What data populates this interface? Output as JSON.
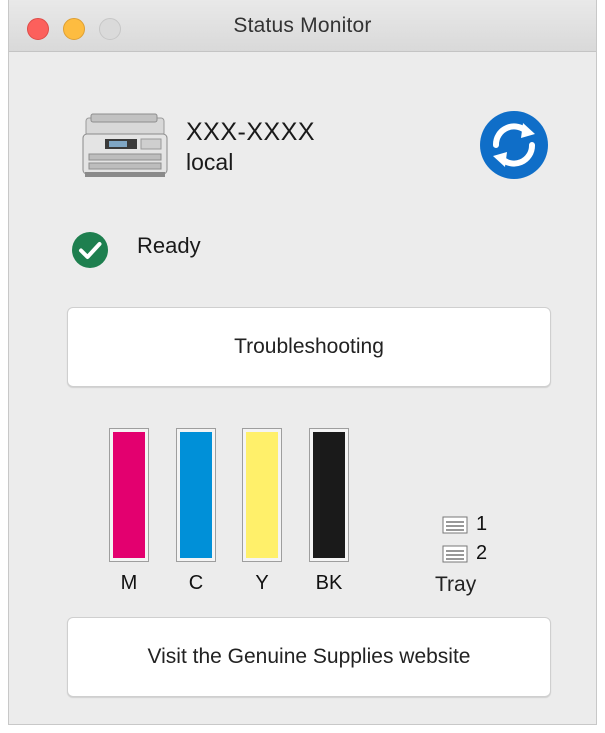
{
  "window": {
    "title": "Status Monitor"
  },
  "device": {
    "name": "XXX-XXXX",
    "connection": "local"
  },
  "status": {
    "text": "Ready",
    "color": "#1e7f4f"
  },
  "buttons": {
    "troubleshooting": "Troubleshooting",
    "supplies": "Visit the Genuine Supplies website"
  },
  "ink": [
    {
      "label": "M",
      "color": "#e3006f",
      "level": 1.0
    },
    {
      "label": "C",
      "color": "#0090d8",
      "level": 1.0
    },
    {
      "label": "Y",
      "color": "#fff06a",
      "level": 1.0
    },
    {
      "label": "BK",
      "color": "#1a1a1a",
      "level": 1.0
    }
  ],
  "trays": {
    "items": [
      "1",
      "2"
    ],
    "label": "Tray"
  },
  "icons": {
    "refresh": "refresh-icon",
    "printer": "printer-icon",
    "status": "check-circle-icon",
    "tray": "tray-icon"
  },
  "colors": {
    "accent": "#0f6ec8"
  }
}
